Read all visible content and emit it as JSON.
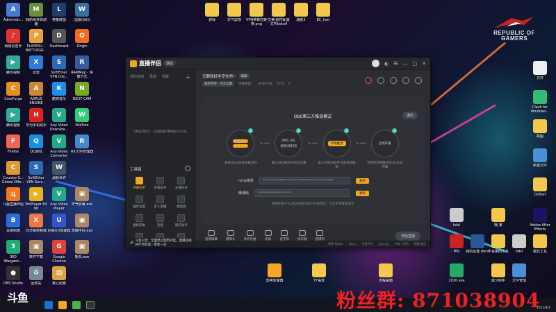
{
  "desktop_left": [
    {
      "label": "Administr...",
      "color": "#4a7bd4",
      "glyph": "A"
    },
    {
      "label": "我的世界启动器",
      "color": "#6b8e3a",
      "glyph": "M"
    },
    {
      "label": "英雄联盟",
      "color": "#1f3d6b",
      "glyph": "L"
    },
    {
      "label": "(国服)网三",
      "color": "#3a6e9e",
      "glyph": "W"
    },
    {
      "label": "网易云音乐",
      "color": "#d33",
      "glyph": "♪"
    },
    {
      "label": "PLAYERU... BATTLEGR...",
      "color": "#e8a33c",
      "glyph": "P"
    },
    {
      "label": "Dashboard",
      "color": "#555",
      "glyph": "D"
    },
    {
      "label": "Origin",
      "color": "#f56c1e",
      "glyph": "O"
    },
    {
      "label": "腾讯视频",
      "color": "#3a9",
      "glyph": "▶"
    },
    {
      "label": "迅雷",
      "color": "#2a7bdc",
      "glyph": "X"
    },
    {
      "label": "SoftEther VPN Clie...",
      "color": "#2b6bb3",
      "glyph": "S"
    },
    {
      "label": "RAMMap - 快捷方式",
      "color": "#3a5a9a",
      "glyph": "R"
    },
    {
      "label": "CoreForge",
      "color": "#e9901c",
      "glyph": "C"
    },
    {
      "label": "AORUS ENGINE",
      "color": "#c83",
      "glyph": "A"
    },
    {
      "label": "酷狗音乐",
      "color": "#1f8ee6",
      "glyph": "K"
    },
    {
      "label": "NZXT CAM",
      "color": "#7a2",
      "glyph": "N"
    },
    {
      "label": "腾讯视频",
      "color": "#3a9",
      "glyph": "▶"
    },
    {
      "label": "华为手机助手",
      "color": "#d22",
      "glyph": "H"
    },
    {
      "label": "Any Video Downloa...",
      "color": "#2a8",
      "glyph": "V"
    },
    {
      "label": "WizTree",
      "color": "#3c7",
      "glyph": "W"
    },
    {
      "label": "Firefox",
      "color": "#e65",
      "glyph": "F"
    },
    {
      "label": "QQ游戏",
      "color": "#1a8fe0",
      "glyph": "Q"
    },
    {
      "label": "Any Video Converter",
      "color": "#2a8",
      "glyph": "V"
    },
    {
      "label": "RX文件管理器",
      "color": "#48c",
      "glyph": "R"
    },
    {
      "label": "Counter-S... Global Offe...",
      "color": "#d93",
      "glyph": "C"
    },
    {
      "label": "SoftEther VPN Serv...",
      "color": "#2b6bb3",
      "glyph": "S"
    },
    {
      "label": "战舰世界",
      "color": "#456",
      "glyph": "W"
    },
    {
      "label": "",
      "color": "#0000",
      "glyph": ""
    },
    {
      "label": "斗鱼直播伴侣",
      "color": "#ef7b1c",
      "glyph": "斗"
    },
    {
      "label": "PotPlayer 64 bit",
      "color": "#e9b21c",
      "glyph": "▶"
    },
    {
      "label": "Any Video Player",
      "color": "#2a8",
      "glyph": "V"
    },
    {
      "label": "天气屏幕.exe",
      "color": "#a86",
      "glyph": "▣"
    },
    {
      "label": "百度网盘",
      "color": "#2b6bdc",
      "glyph": "B"
    },
    {
      "label": "向日葵控制端",
      "color": "#e74",
      "glyph": "X"
    },
    {
      "label": "网易UU加速器",
      "color": "#35c",
      "glyph": "U"
    },
    {
      "label": "直播伴侣.exe",
      "color": "#a86",
      "glyph": "▣"
    },
    {
      "label": "360 Wargami...",
      "color": "#2a7",
      "glyph": "3"
    },
    {
      "label": "软件下载",
      "color": "#a86",
      "glyph": "▣"
    },
    {
      "label": "Google Chrome",
      "color": "#db4437",
      "glyph": "G"
    },
    {
      "label": "新机.exe",
      "color": "#a86",
      "glyph": "▣"
    },
    {
      "label": "OBS Studio",
      "color": "#333",
      "glyph": "●"
    },
    {
      "label": "回收站",
      "color": "#789",
      "glyph": "♻"
    },
    {
      "label": "核心配置",
      "color": "#d9a441",
      "glyph": "▤"
    }
  ],
  "desktop_top": [
    {
      "label": "游戏",
      "color": "#f2c94c"
    },
    {
      "label": "天气屏部",
      "color": "#f2c94c"
    },
    {
      "label": "VPN参数拉转换.png",
      "color": "#f2c94c"
    },
    {
      "label": "艾佛-韵控配置文件beta4",
      "color": "#f2c94c"
    },
    {
      "label": "减肥3",
      "color": "#f2c94c"
    },
    {
      "label": "BC_test",
      "color": "#f2c94c"
    }
  ],
  "desktop_right": [
    {
      "label": "文件",
      "color": "#eee"
    },
    {
      "label": "Clash for Windows...",
      "color": "#3b7"
    },
    {
      "label": "截图",
      "color": "#f2c94c"
    },
    {
      "label": "新建文件",
      "color": "#4a90d9"
    },
    {
      "label": "DoText",
      "color": "#f2c94c"
    },
    {
      "label": "hdsl",
      "color": "#ccc"
    },
    {
      "label": "哦-家",
      "color": "#f2c94c"
    },
    {
      "label": "Adobe After Effects",
      "color": "#1b1464"
    },
    {
      "label": "MSI",
      "color": "#c22"
    },
    {
      "label": "我的设置.docx",
      "color": "#2b5797"
    },
    {
      "label": "不会用的工具",
      "color": "#f2c94c"
    },
    {
      "label": "hdsl",
      "color": "#ccc"
    },
    {
      "label": "模式工具",
      "color": "#f2c94c"
    },
    {
      "label": "2020.exe",
      "color": "#2a6"
    },
    {
      "label": "蓝牙助手",
      "color": "#f2c94c"
    },
    {
      "label": "文件管理",
      "color": "#4a90d9"
    }
  ],
  "desktop_bottom_mid": [
    {
      "label": "雷神加速器",
      "color": "#f5a623"
    },
    {
      "label": "YY语音",
      "color": "#f2c94c"
    },
    {
      "label": "远程桌面",
      "color": "#f2c94c"
    }
  ],
  "rog": {
    "line1": "REPUBLIC OF",
    "line2": "GAMERS"
  },
  "app": {
    "name": "直播伴侣",
    "version_badge": "测试",
    "left_tabs": [
      "我的直播",
      "看客",
      "弹幕"
    ],
    "empty_text": "0粉丝/暂无！ 0场直播的数据统计记录",
    "tools_title": "工具箱",
    "tools": [
      {
        "label": "弹幕助手",
        "hot": true
      },
      {
        "label": "房管助手",
        "hot": false
      },
      {
        "label": "主播任务",
        "hot": false
      },
      {
        "label": "抽奖设置",
        "hot": false
      },
      {
        "label": "多人直播",
        "hot": false
      },
      {
        "label": "播放器",
        "hot": false
      },
      {
        "label": "虚拟形象",
        "hot": false
      },
      {
        "label": "连麦",
        "hot": false
      },
      {
        "label": "聊天助手",
        "hot": false
      },
      {
        "label": "更多功能",
        "hot": false
      },
      {
        "label": "运营",
        "hot": false
      },
      {
        "label": "数据中心",
        "hot": false
      }
    ],
    "ticker": "斗鱼公告：全面禁止使用外挂，直播违规将严肃处理 · 更新一览",
    "room_title": "无聊就好全空先吧~",
    "room_edit": "编辑",
    "room_chip": "我的世界 · 内含全部",
    "room_meta": [
      "常规热度：",
      "9749278",
      "7572",
      "0"
    ],
    "mode_title": "OBS第三方推流模式",
    "exit_label": "退出",
    "steps": [
      {
        "n": "1",
        "inner": "",
        "caption": "复制rtmp地址和推流码"
      },
      {
        "n": "2",
        "inner": "RMS URL",
        "inner2": "秘钥/串码流",
        "caption": "填入OBS推流中对应位置"
      },
      {
        "n": "3",
        "inner": "开始推流",
        "inner2": "",
        "caption": "第三方推流软件点击开始推流"
      },
      {
        "n": "4",
        "inner": "启动开播",
        "inner2": "",
        "caption": "伴侣检测到推流信号 启动开播"
      }
    ],
    "rtmp_label": "rtmp地址",
    "rtmp_value": "**********************************",
    "key_label": "推流码",
    "key_value": "****************",
    "copy_label": "复制",
    "note": "直播开始rtmp地址和推流码均不要修改，下次无需重复填写",
    "bottom_tools": [
      "直播屏幕",
      "摄像头",
      "多机位推",
      "投屏",
      "麦克风",
      "扬声器",
      "直播码"
    ],
    "start_label": "开始直播",
    "status": [
      "码率 0kbps",
      "FPS:0",
      "丢帧 0%",
      "CPU:4%",
      "内存 :14%",
      "网络 延迟"
    ]
  },
  "taskbar": {
    "brand": "斗鱼"
  },
  "watermark": "粉丝群: 871038904",
  "clock": {
    "date": "2021/8/1"
  }
}
